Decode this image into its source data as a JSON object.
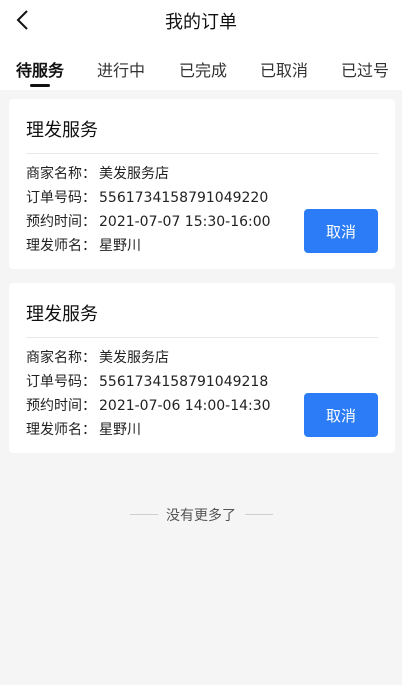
{
  "nav": {
    "title": "我的订单"
  },
  "tabs": [
    {
      "label": "待服务",
      "active": true
    },
    {
      "label": "进行中",
      "active": false
    },
    {
      "label": "已完成",
      "active": false
    },
    {
      "label": "已取消",
      "active": false
    },
    {
      "label": "已过号",
      "active": false
    }
  ],
  "field_labels": {
    "shop": "商家名称：",
    "order_no": "订单号码：",
    "time": "预约时间：",
    "barber": "理发师名："
  },
  "orders": [
    {
      "service": "理发服务",
      "shop": "美发服务店",
      "order_no": "5561734158791049220",
      "time": "2021-07-07 15:30-16:00",
      "barber": "星野川",
      "cancel_label": "取消"
    },
    {
      "service": "理发服务",
      "shop": "美发服务店",
      "order_no": "5561734158791049218",
      "time": "2021-07-06 14:00-14:30",
      "barber": "星野川",
      "cancel_label": "取消"
    }
  ],
  "footer": {
    "no_more": "没有更多了"
  },
  "colors": {
    "accent": "#2b7cf6",
    "background": "#f5f5f5"
  }
}
